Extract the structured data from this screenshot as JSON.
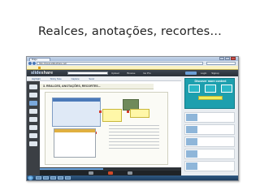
{
  "slide": {
    "title": "Realces, anotações, recortes…"
  },
  "browser": {
    "tab_label": "Diigo",
    "url": "http://www.slideshare.net/"
  },
  "site": {
    "logo_left": "slide",
    "logo_right": "share",
    "nav_links": [
      "Upload",
      "Browse",
      "Go Pro"
    ],
    "login_links": [
      "Login",
      "Signup"
    ]
  },
  "toolbar": {
    "items": [
      "Highlight",
      "Sticky Note",
      "Capture",
      "Send"
    ]
  },
  "document": {
    "title": "3. REALCES, ANOTAÇÕES, RECORTES..."
  },
  "player": {
    "progress_fraction": 0.45
  },
  "sidebar": {
    "promo_title": "Discover more content"
  },
  "colors": {
    "promo": "#1d9fae",
    "site_header": "#2f353c",
    "accent_red": "#d63a2a"
  }
}
